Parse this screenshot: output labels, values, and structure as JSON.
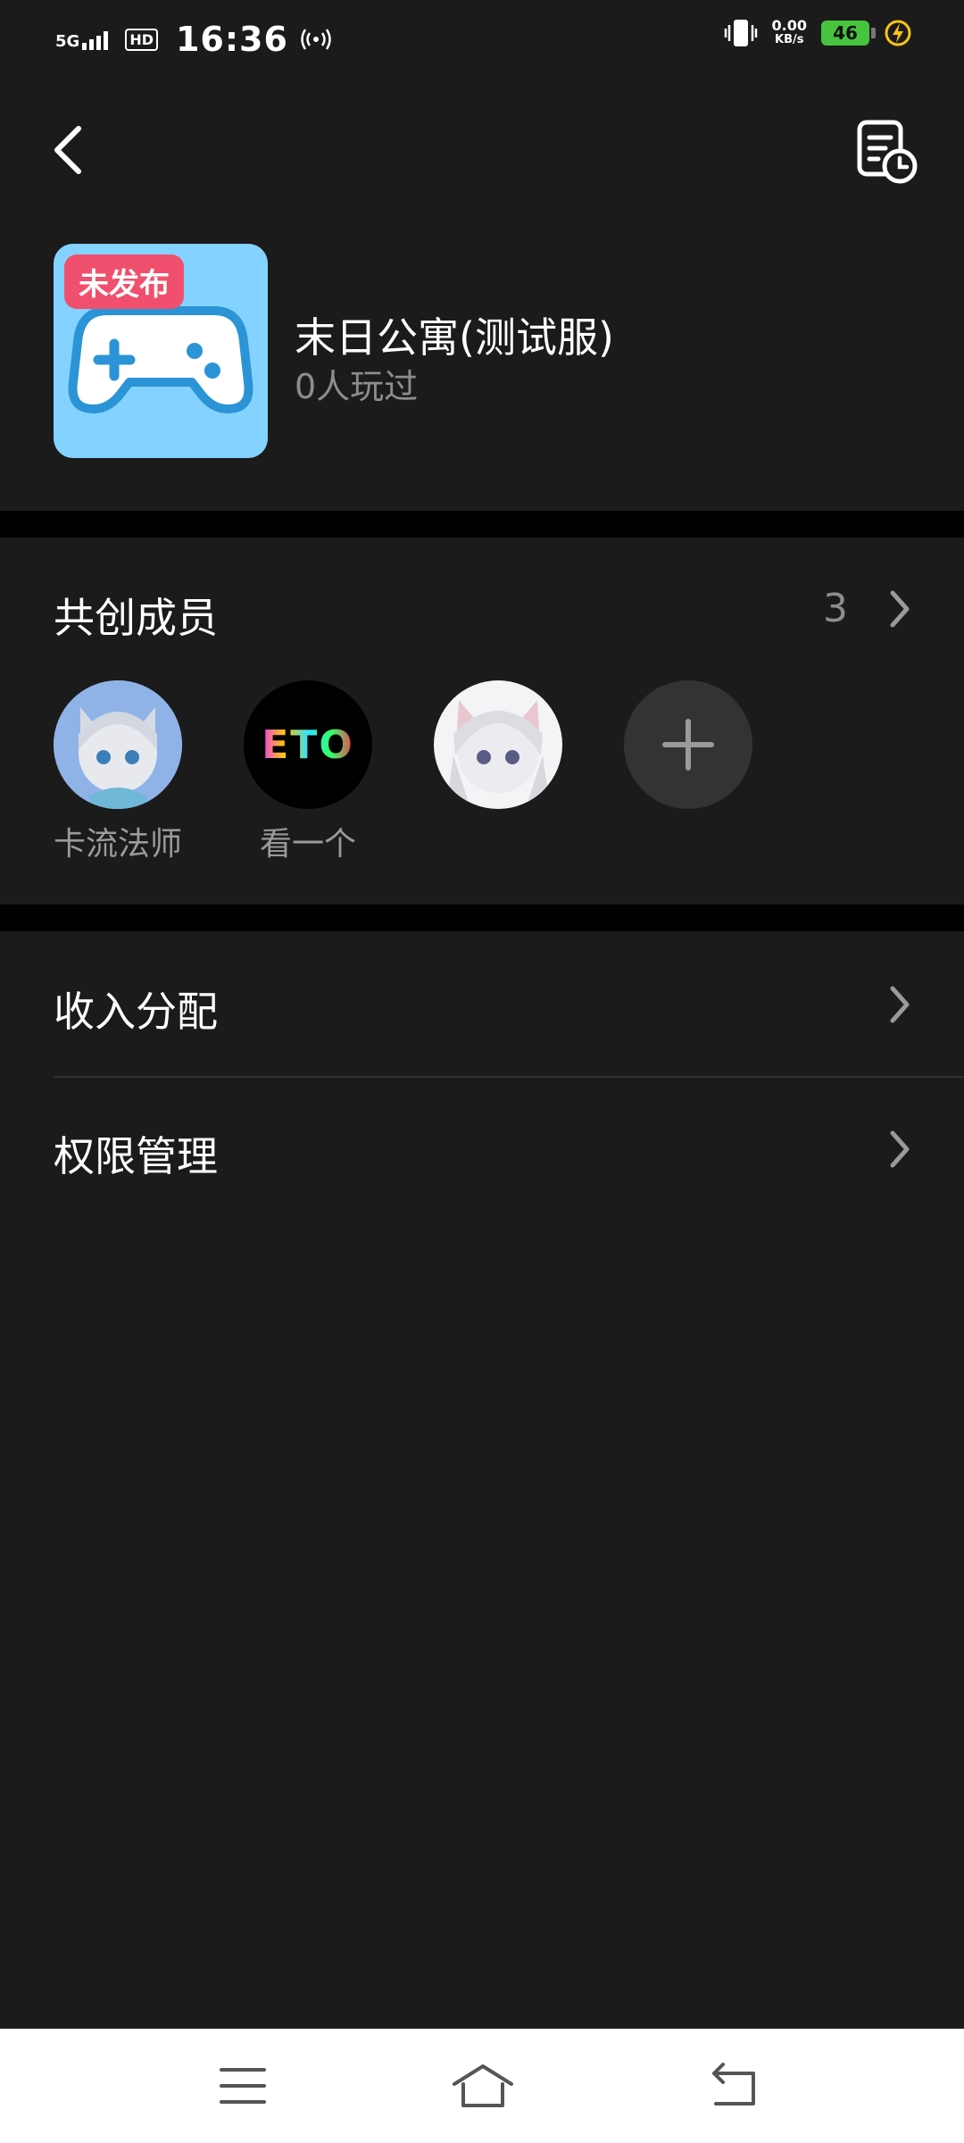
{
  "status_bar": {
    "network": "5G",
    "hd": "HD",
    "time": "16:36",
    "speed_value": "0.00",
    "speed_unit": "KB/s",
    "battery": "46"
  },
  "icons": {
    "back": "chevron-left-icon",
    "record": "document-clock-icon",
    "game": "gamepad-icon",
    "add": "plus-icon",
    "chevron": "chevron-right-icon"
  },
  "game": {
    "badge": "未发布",
    "title": "末日公寓(测试服)",
    "players": "0人玩过"
  },
  "members": {
    "title": "共创成员",
    "count": "3",
    "list": [
      {
        "name": "卡流法师"
      },
      {
        "name": "看一个",
        "avatar_text": "ETO"
      },
      {
        "name": ""
      }
    ]
  },
  "menu": {
    "income": "收入分配",
    "permission": "权限管理"
  },
  "colors": {
    "background": "#1b1b1b",
    "badge": "#f0506d",
    "game_icon_bg": "#84d2ff",
    "battery": "#47c33f"
  }
}
